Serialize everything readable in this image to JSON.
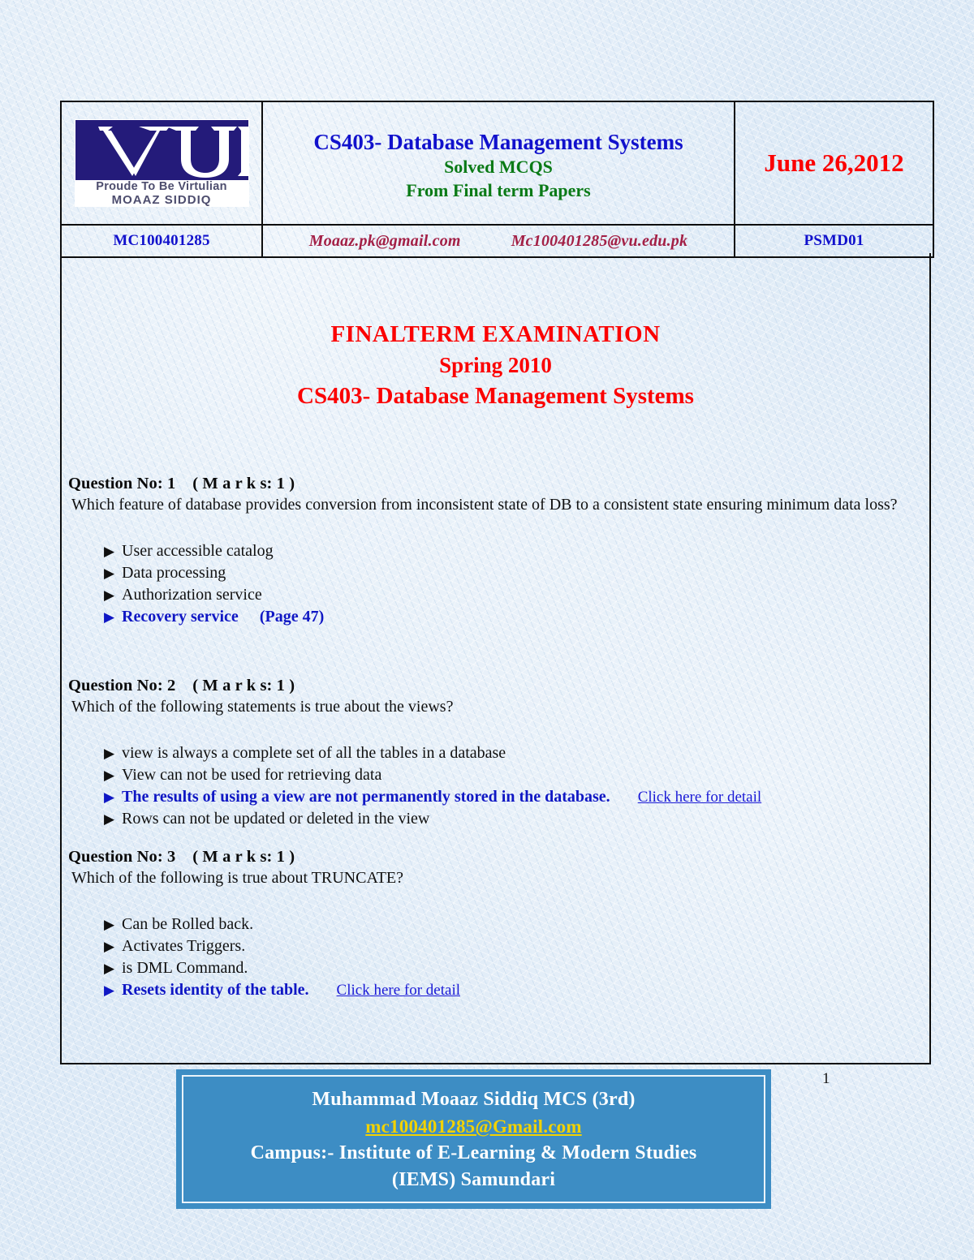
{
  "document": {
    "background_color": "#dce9f6",
    "page_number": "1"
  },
  "header": {
    "logo": {
      "letters": "VU",
      "tagline1": "Proude To Be Virtulian",
      "tagline2": "MOAAZ SIDDIQ",
      "mark_color": "#241b7a"
    },
    "course_title": "CS403- Database Management Systems",
    "subtitle1": "Solved MCQS",
    "subtitle2": "From Final term Papers",
    "date": "June 26,2012",
    "roll_no": "MC100401285",
    "email1": "Moaaz.pk@gmail.com",
    "email2": "Mc100401285@vu.edu.pk",
    "paper_code": "PSMD01",
    "colors": {
      "course_title": "#1111cc",
      "subtitle": "#0a7a16",
      "date": "#fb0000",
      "email": "#a32046",
      "roll": "#1111cc"
    }
  },
  "exam_title": {
    "line1": "FINALTERM  EXAMINATION",
    "line2": "Spring 2010",
    "line3": "CS403- Database Management Systems",
    "color": "#fb0000"
  },
  "questions": [
    {
      "head": "Question No: 1    ( M a r k s: 1 )",
      "text": " Which feature of database provides conversion from inconsistent state of DB to a consistent state ensuring minimum data loss?",
      "options": [
        {
          "label": "User accessible catalog",
          "correct": false,
          "note": "",
          "link": ""
        },
        {
          "label": "Data processing",
          "correct": false,
          "note": "",
          "link": ""
        },
        {
          "label": "Authorization service",
          "correct": false,
          "note": "",
          "link": ""
        },
        {
          "label": "Recovery service",
          "correct": true,
          "note": "(Page 47)",
          "link": ""
        }
      ]
    },
    {
      "head": "Question No: 2    ( M a r k s: 1 )",
      "text": " Which of the following statements is true about the views?",
      "options": [
        {
          "label": "view is always a complete set of all the tables in a database",
          "correct": false,
          "note": "",
          "link": ""
        },
        {
          "label": "View can not be used for retrieving data",
          "correct": false,
          "note": "",
          "link": ""
        },
        {
          "label": "The results of using a view are not permanently stored in the database.",
          "correct": true,
          "note": "",
          "link": "Click here for detail"
        },
        {
          "label": "Rows can not be updated or deleted in the view",
          "correct": false,
          "note": "",
          "link": ""
        }
      ]
    },
    {
      "head": "Question No: 3    ( M a r k s: 1 )",
      "text": " Which of the following is true about TRUNCATE?",
      "options": [
        {
          "label": "Can be Rolled back.",
          "correct": false,
          "note": "",
          "link": ""
        },
        {
          "label": "Activates Triggers.",
          "correct": false,
          "note": "",
          "link": ""
        },
        {
          "label": "is DML Command.",
          "correct": false,
          "note": "",
          "link": ""
        },
        {
          "label": "Resets identity of the table.",
          "correct": true,
          "note": "",
          "link": "Click here for detail"
        }
      ]
    }
  ],
  "footer": {
    "name": "Muhammad Moaaz  Siddiq MCS (3rd)",
    "email": "mc100401285@Gmail.com",
    "campus_line1": "Campus:- Institute of E-Learning & Modern Studies",
    "campus_line2": "(IEMS) Samundari",
    "box_color": "#3d8dc4",
    "email_color": "#f2d200"
  }
}
